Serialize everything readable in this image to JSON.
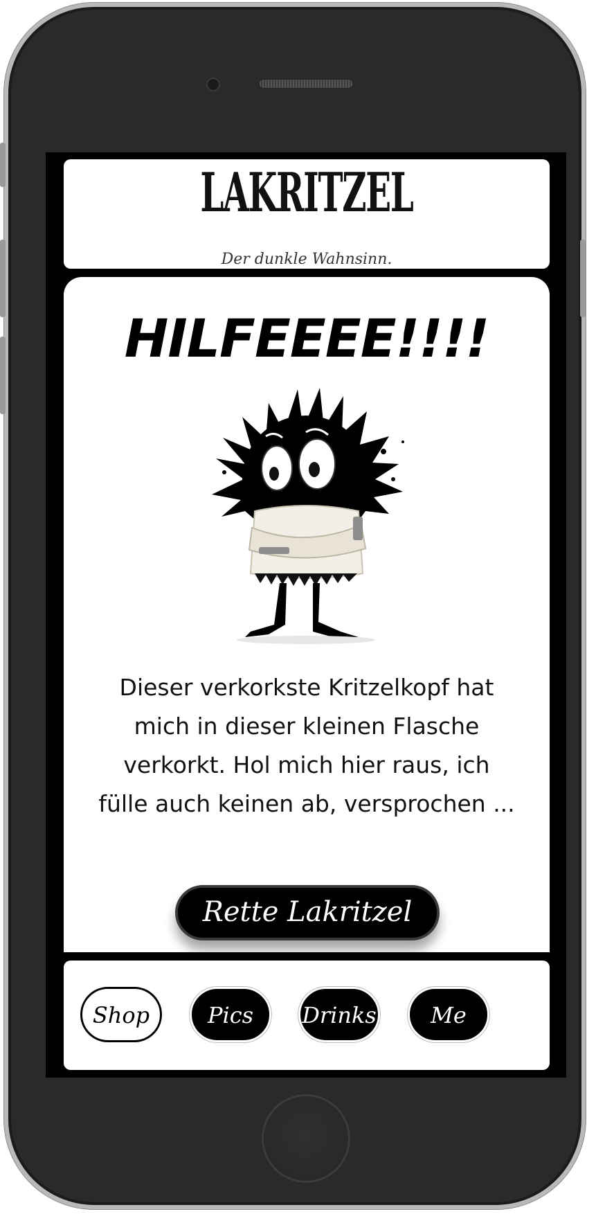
{
  "header": {
    "logo_text": "LAKRITZEL",
    "tagline": "Der dunkle Wahnsinn."
  },
  "main": {
    "headline": "HILFEEEE!!!!",
    "illustration": "ink-blot creature in straitjacket",
    "body": "Dieser verkorkste Kritzelkopf hat mich in dieser kleinen Flasche verkorkt. Hol mich hier raus, ich fülle auch keinen ab, versprochen ...",
    "cta_label": "Rette Lakritzel"
  },
  "nav": {
    "items": [
      {
        "label": "Shop",
        "active": true
      },
      {
        "label": "Pics",
        "active": false
      },
      {
        "label": "Drinks",
        "active": false
      },
      {
        "label": "Me",
        "active": false
      }
    ]
  },
  "colors": {
    "screen_background": "#000000",
    "card_background": "#ffffff",
    "accent": "#000000"
  }
}
